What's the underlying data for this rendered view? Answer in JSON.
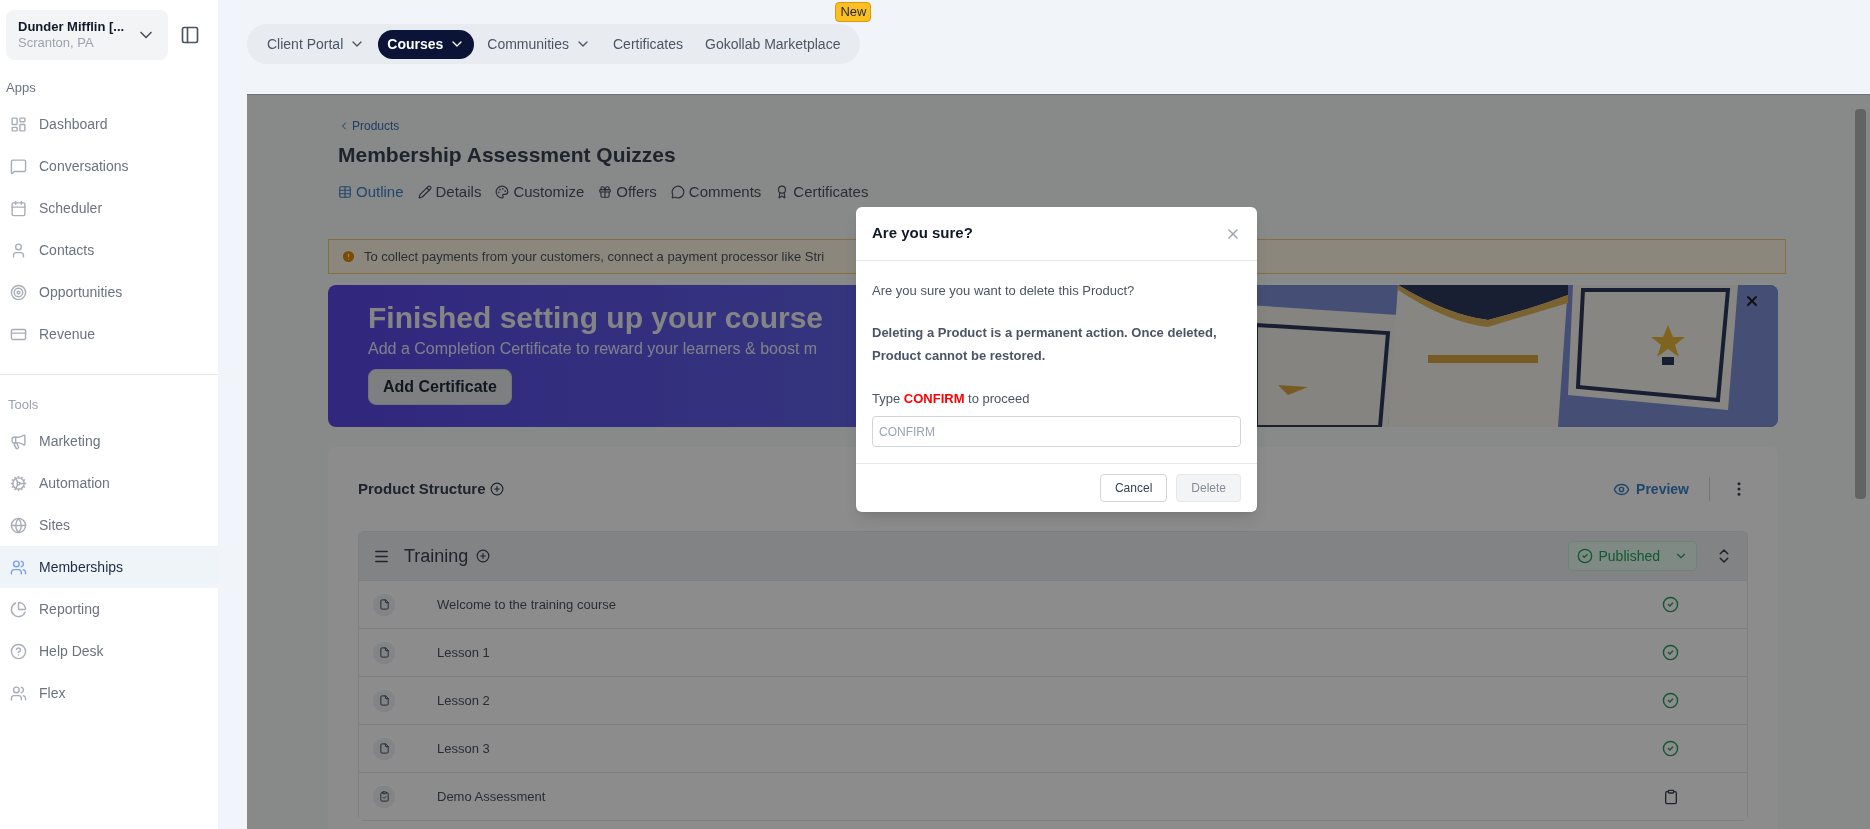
{
  "account": {
    "name": "Dunder Mifflin [...",
    "location": "Scranton, PA"
  },
  "sidebar": {
    "sections": [
      {
        "title": "Apps",
        "items": [
          {
            "label": "Dashboard",
            "selected": false
          },
          {
            "label": "Conversations",
            "selected": false
          },
          {
            "label": "Scheduler",
            "selected": false
          },
          {
            "label": "Contacts",
            "selected": false
          },
          {
            "label": "Opportunities",
            "selected": false
          },
          {
            "label": "Revenue",
            "selected": false
          }
        ]
      },
      {
        "title": "Tools",
        "items": [
          {
            "label": "Marketing",
            "selected": false
          },
          {
            "label": "Automation",
            "selected": false
          },
          {
            "label": "Sites",
            "selected": false
          },
          {
            "label": "Memberships",
            "selected": true
          },
          {
            "label": "Reporting",
            "selected": false
          },
          {
            "label": "Help Desk",
            "selected": false
          },
          {
            "label": "Flex",
            "selected": false
          }
        ]
      }
    ]
  },
  "top_nav": {
    "items": [
      {
        "label": "Client Portal",
        "selected": false,
        "has_menu": true
      },
      {
        "label": "Courses",
        "selected": true,
        "has_menu": true
      },
      {
        "label": "Communities",
        "selected": false,
        "has_menu": true
      },
      {
        "label": "Certificates",
        "selected": false,
        "has_menu": false
      },
      {
        "label": "Gokollab Marketplace",
        "selected": false,
        "has_menu": false,
        "badge": "New"
      }
    ]
  },
  "page": {
    "back_link": "Products",
    "title": "Membership Assessment Quizzes",
    "tabs": [
      {
        "label": "Outline",
        "selected": true
      },
      {
        "label": "Details",
        "selected": false
      },
      {
        "label": "Customize",
        "selected": false
      },
      {
        "label": "Offers",
        "selected": false
      },
      {
        "label": "Comments",
        "selected": false
      },
      {
        "label": "Certificates",
        "selected": false
      }
    ],
    "alert": "To collect payments from your customers, connect a payment processor like Stri",
    "banner": {
      "title": "Finished setting up your course",
      "subtitle": "Add a Completion Certificate to reward your learners & boost m",
      "button": "Add Certificate"
    },
    "structure": {
      "title": "Product Structure",
      "preview": "Preview",
      "section": {
        "title": "Training",
        "status": "Published",
        "lessons": [
          {
            "title": "Welcome to the training course",
            "kind": "lesson"
          },
          {
            "title": "Lesson 1",
            "kind": "lesson"
          },
          {
            "title": "Lesson 2",
            "kind": "lesson"
          },
          {
            "title": "Lesson 3",
            "kind": "lesson"
          },
          {
            "title": "Demo Assessment",
            "kind": "assessment"
          }
        ]
      }
    }
  },
  "dialog": {
    "title": "Are you sure?",
    "message": "Are you sure you want to delete this Product?",
    "warning": "Deleting a Product is a permanent action. Once deleted, Product cannot be restored.",
    "prompt_before": "Type",
    "keyword": "CONFIRM",
    "prompt_after": "to proceed",
    "placeholder": "CONFIRM",
    "buttons": [
      {
        "label": "Cancel",
        "disabled": false
      },
      {
        "label": "Delete",
        "disabled": true
      }
    ]
  }
}
